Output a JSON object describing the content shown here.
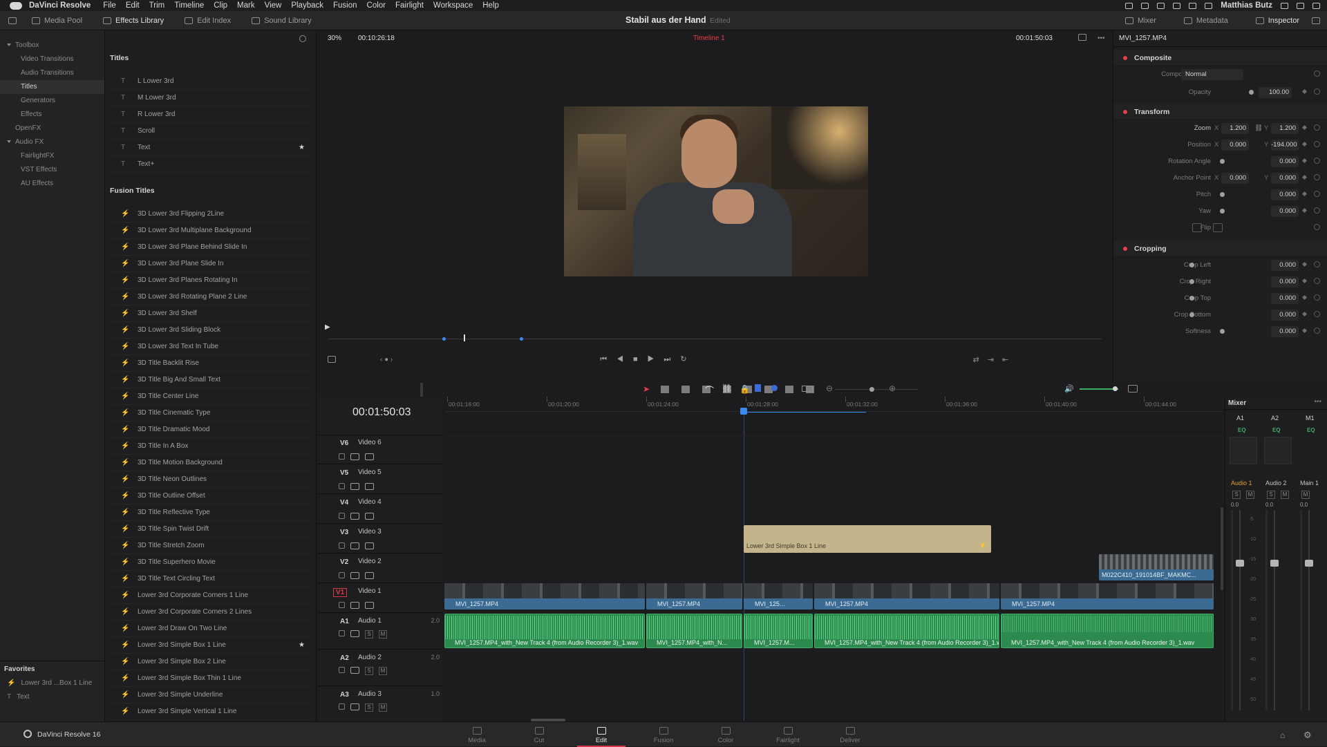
{
  "menubar": {
    "app_name": "DaVinci Resolve",
    "items": [
      "File",
      "Edit",
      "Trim",
      "Timeline",
      "Clip",
      "Mark",
      "View",
      "Playback",
      "Fusion",
      "Color",
      "Fairlight",
      "Workspace",
      "Help"
    ],
    "user": "Matthias Butz"
  },
  "toolbar": {
    "left": [
      "Media Pool",
      "Effects Library",
      "Edit Index",
      "Sound Library"
    ],
    "project_title": "Stabil aus der Hand",
    "project_status": "Edited",
    "right": [
      "Mixer",
      "Metadata",
      "Inspector"
    ]
  },
  "toolbox_nav": [
    {
      "label": "Toolbox",
      "level": 0,
      "expanded": true
    },
    {
      "label": "Video Transitions",
      "level": 1
    },
    {
      "label": "Audio Transitions",
      "level": 1
    },
    {
      "label": "Titles",
      "level": 1,
      "selected": true
    },
    {
      "label": "Generators",
      "level": 1
    },
    {
      "label": "Effects",
      "level": 1
    },
    {
      "label": "OpenFX",
      "level": 0
    },
    {
      "label": "Audio FX",
      "level": 0,
      "expanded": true
    },
    {
      "label": "FairlightFX",
      "level": 1
    },
    {
      "label": "VST Effects",
      "level": 1
    },
    {
      "label": "AU Effects",
      "level": 1
    }
  ],
  "favorites": {
    "header": "Favorites",
    "items": [
      {
        "icon": "fusion",
        "label": "Lower 3rd ...Box 1 Line"
      },
      {
        "icon": "T",
        "label": "Text"
      }
    ]
  },
  "titles": {
    "header": "Titles",
    "items": [
      {
        "label": "L Lower 3rd"
      },
      {
        "label": "M Lower 3rd"
      },
      {
        "label": "R Lower 3rd"
      },
      {
        "label": "Scroll"
      },
      {
        "label": "Text",
        "fav": true
      },
      {
        "label": "Text+"
      }
    ]
  },
  "fusion_titles": {
    "header": "Fusion Titles",
    "items": [
      {
        "label": "3D Lower 3rd Flipping 2Line"
      },
      {
        "label": "3D Lower 3rd Multiplane Background"
      },
      {
        "label": "3D Lower 3rd Plane Behind Slide In"
      },
      {
        "label": "3D Lower 3rd Plane Slide In"
      },
      {
        "label": "3D Lower 3rd Planes Rotating In"
      },
      {
        "label": "3D Lower 3rd Rotating Plane 2 Line"
      },
      {
        "label": "3D Lower 3rd Shelf"
      },
      {
        "label": "3D Lower 3rd Sliding Block"
      },
      {
        "label": "3D Lower 3rd Text In Tube"
      },
      {
        "label": "3D Title Backlit Rise"
      },
      {
        "label": "3D Title Big And Small Text"
      },
      {
        "label": "3D Title Center Line"
      },
      {
        "label": "3D Title Cinematic Type"
      },
      {
        "label": "3D Title Dramatic Mood"
      },
      {
        "label": "3D Title In A Box"
      },
      {
        "label": "3D Title Motion Background"
      },
      {
        "label": "3D Title Neon Outlines"
      },
      {
        "label": "3D Title Outline Offset"
      },
      {
        "label": "3D Title Reflective Type"
      },
      {
        "label": "3D Title Spin Twist Drift"
      },
      {
        "label": "3D Title Stretch Zoom"
      },
      {
        "label": "3D Title Superhero Movie"
      },
      {
        "label": "3D Title Text Circling Text"
      },
      {
        "label": "Lower 3rd Corporate Corners 1 Line"
      },
      {
        "label": "Lower 3rd Corporate Corners 2 Lines"
      },
      {
        "label": "Lower 3rd Draw On Two Line"
      },
      {
        "label": "Lower 3rd Simple Box 1 Line",
        "fav": true
      },
      {
        "label": "Lower 3rd Simple Box 2 Line"
      },
      {
        "label": "Lower 3rd Simple Box Thin 1 Line"
      },
      {
        "label": "Lower 3rd Simple Underline"
      },
      {
        "label": "Lower 3rd Simple Vertical 1 Line"
      }
    ]
  },
  "viewer": {
    "zoom": "30%",
    "source_timecode": "00:10:26:18",
    "timeline_name": "Timeline 1",
    "record_timecode": "00:01:50:03",
    "clip_name": "MVI_1257.MP4"
  },
  "inspector": {
    "composite": {
      "header": "Composite",
      "mode_label": "Composite Mode",
      "mode_value": "Normal",
      "opacity_label": "Opacity",
      "opacity_value": "100.00"
    },
    "transform": {
      "header": "Transform",
      "zoom_label": "Zoom",
      "zoom_x": "1.200",
      "zoom_y": "1.200",
      "position_label": "Position",
      "position_x": "0.000",
      "position_y": "-194.000",
      "rotation_label": "Rotation Angle",
      "rotation_value": "0.000",
      "anchor_label": "Anchor Point",
      "anchor_x": "0.000",
      "anchor_y": "0.000",
      "pitch_label": "Pitch",
      "pitch_value": "0.000",
      "yaw_label": "Yaw",
      "yaw_value": "0.000",
      "flip_label": "Flip"
    },
    "cropping": {
      "header": "Cropping",
      "rows": [
        {
          "label": "Crop Left",
          "value": "0.000"
        },
        {
          "label": "Crop Right",
          "value": "0.000"
        },
        {
          "label": "Crop Top",
          "value": "0.000"
        },
        {
          "label": "Crop Bottom",
          "value": "0.000"
        },
        {
          "label": "Softness",
          "value": "0.000"
        }
      ]
    }
  },
  "timeline": {
    "timecode": "00:01:50:03",
    "ruler": [
      "00:01:16:00",
      "00:01:20:00",
      "00:01:24:00",
      "00:01:28:00",
      "00:01:32:00",
      "00:01:36:00",
      "00:01:40:00",
      "00:01:44:00"
    ],
    "video_tracks": [
      {
        "code": "V6",
        "name": "Video 6"
      },
      {
        "code": "V5",
        "name": "Video 5"
      },
      {
        "code": "V4",
        "name": "Video 4"
      },
      {
        "code": "V3",
        "name": "Video 3"
      },
      {
        "code": "V2",
        "name": "Video 2"
      },
      {
        "code": "V1",
        "name": "Video 1"
      }
    ],
    "audio_tracks": [
      {
        "code": "A1",
        "name": "Audio 1",
        "ch": "2.0"
      },
      {
        "code": "A2",
        "name": "Audio 2",
        "ch": "2.0"
      },
      {
        "code": "A3",
        "name": "Audio 3",
        "ch": "1.0"
      }
    ],
    "title_clip": "Lower 3rd Simple Box 1 Line",
    "v2_clip": "M022C410_191014BF_MAKMC...",
    "v1_clips": [
      "MVI_1257.MP4",
      "MVI_1257.MP4",
      "MVI_125...",
      "MVI_1257.MP4",
      "MVI_1257.MP4"
    ],
    "a1_clips": [
      "MVI_1257.MP4_with_New Track 4 (from Audio Recorder 3)_1.wav",
      "MVI_1257.MP4_with_N...",
      "MVI_1257.M...",
      "MVI_1257.MP4_with_New Track 4 (from Audio Recorder 3)_1.wav",
      "MVI_1257.MP4_with_New Track 4 (from Audio Recorder 3)_1.wav"
    ]
  },
  "mixer": {
    "title": "Mixer",
    "channels": [
      "A1",
      "A2",
      "M1"
    ],
    "eq": "EQ",
    "strip_names": [
      "Audio 1",
      "Audio 2",
      "Main 1"
    ],
    "db": "0.0",
    "scale": [
      "-5",
      "-10",
      "-15",
      "-20",
      "-25",
      "-30",
      "-35",
      "-40",
      "-45",
      "-50"
    ]
  },
  "bottom": {
    "brand": "DaVinci Resolve 16",
    "pages": [
      "Media",
      "Cut",
      "Edit",
      "Fusion",
      "Color",
      "Fairlight",
      "Deliver"
    ],
    "active_page": "Edit"
  },
  "colors": {
    "accent": "#d63a4a",
    "video_clip": "#3b6b93",
    "audio_clip": "#2d8a4e",
    "title_clip": "#c3b48c"
  }
}
